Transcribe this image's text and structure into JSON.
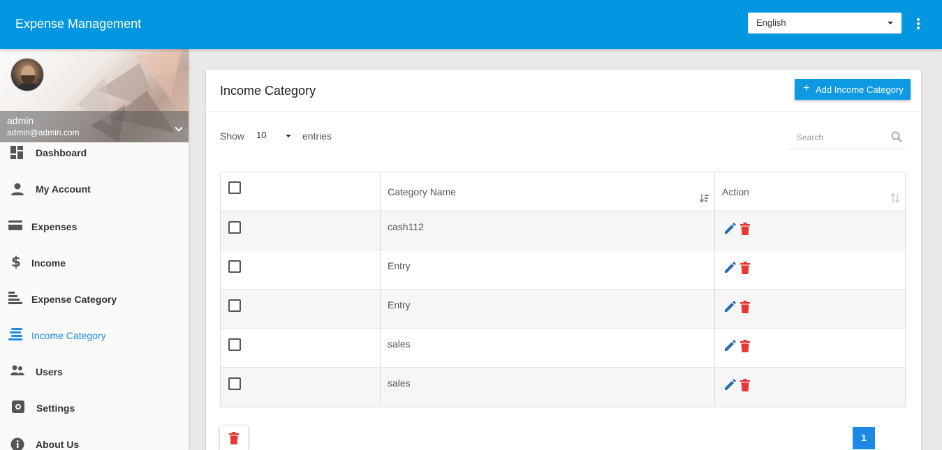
{
  "app": {
    "title": "Expense Management"
  },
  "header": {
    "language": "English"
  },
  "profile": {
    "name": "admin",
    "email": "admin@admin.com"
  },
  "sidebar": {
    "items": [
      {
        "label": "Dashboard",
        "icon": "dashboard-icon"
      },
      {
        "label": "My Account",
        "icon": "person-icon"
      },
      {
        "label": "Expenses",
        "icon": "credit-card-icon"
      },
      {
        "label": "Income",
        "icon": "dollar-icon"
      },
      {
        "label": "Expense Category",
        "icon": "sort-lines-icon"
      },
      {
        "label": "Income Category",
        "icon": "stack-lines-icon",
        "active": true
      },
      {
        "label": "Users",
        "icon": "people-icon"
      },
      {
        "label": "Settings",
        "icon": "gear-icon"
      },
      {
        "label": "About Us",
        "icon": "info-icon"
      }
    ]
  },
  "page": {
    "title": "Income Category",
    "add_button": "Add Income Category",
    "show_label": "Show",
    "page_length": "10",
    "entries_label": "entries",
    "search_placeholder": "Search"
  },
  "table": {
    "columns": [
      "",
      "Category Name",
      "Action"
    ],
    "rows": [
      {
        "name": "cash112"
      },
      {
        "name": "Entry"
      },
      {
        "name": "Entry"
      },
      {
        "name": "sales"
      },
      {
        "name": "sales"
      }
    ]
  },
  "pagination": {
    "current": "1"
  },
  "colors": {
    "primary": "#0097e0",
    "accent": "#1e88e5",
    "edit": "#2b6cb0",
    "delete": "#e53935"
  }
}
